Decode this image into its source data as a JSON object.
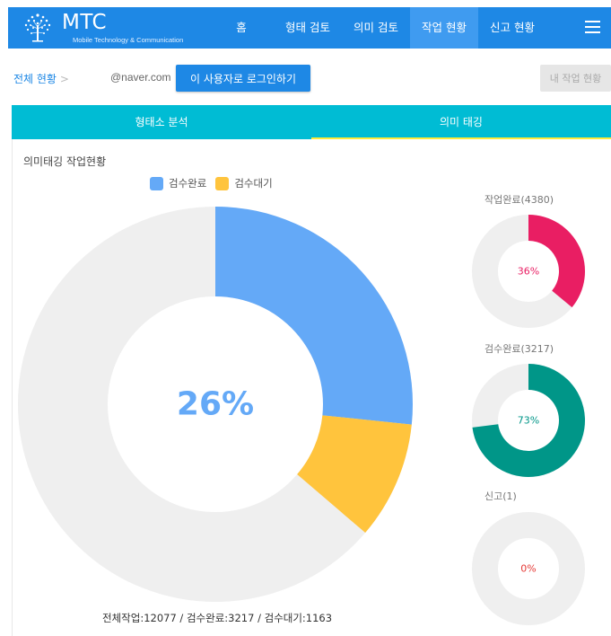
{
  "nav": {
    "logo_title": "MTC",
    "logo_subtitle": "Mobile Technology & Communication",
    "items": [
      {
        "label": "홈"
      },
      {
        "label": "형태 검토"
      },
      {
        "label": "의미 검토"
      },
      {
        "label": "작업 현황"
      },
      {
        "label": "신고 현황"
      }
    ],
    "active_index": 3,
    "menu_icon": "hamburger-icon"
  },
  "subheader": {
    "breadcrumb": "전체 현황",
    "breadcrumb_sep": ">",
    "user_email": "@naver.com",
    "login_as_user_label": "이 사용자로 로그인하기",
    "my_work_label": "내 작업 현황"
  },
  "tabs": [
    {
      "label": "형태소 분석"
    },
    {
      "label": "의미 태깅"
    }
  ],
  "active_tab": 1,
  "panel": {
    "title": "의미태깅 작업현황",
    "summary": "전체작업:12077 / 검수완료:3217 / 검수대기:1163"
  },
  "colors": {
    "accent": "#1e88e5",
    "tab_bg": "#00bcd4",
    "tab_indicator": "#ffeb3b",
    "review_done": "#64a9f7",
    "review_wait": "#ffc43d",
    "ring_bg": "#efefef",
    "work_done": "#e91e63",
    "review_completed": "#009688"
  },
  "chart_data": [
    {
      "type": "pie",
      "center_label": "26%",
      "legend": [
        {
          "name": "검수완료",
          "color": "#64a9f7"
        },
        {
          "name": "검수대기",
          "color": "#ffc43d"
        }
      ],
      "values": [
        {
          "name": "검수완료",
          "value": 3217
        },
        {
          "name": "검수대기",
          "value": 1163
        }
      ],
      "total": 12077
    },
    {
      "type": "pie",
      "title": "작업완료(4380)",
      "center_label": "36%",
      "percent": 36,
      "color": "#e91e63"
    },
    {
      "type": "pie",
      "title": "검수완료(3217)",
      "center_label": "73%",
      "percent": 73,
      "color": "#009688"
    },
    {
      "type": "pie",
      "title": "신고(1)",
      "center_label": "0%",
      "percent": 0,
      "color": "#e53935"
    }
  ]
}
